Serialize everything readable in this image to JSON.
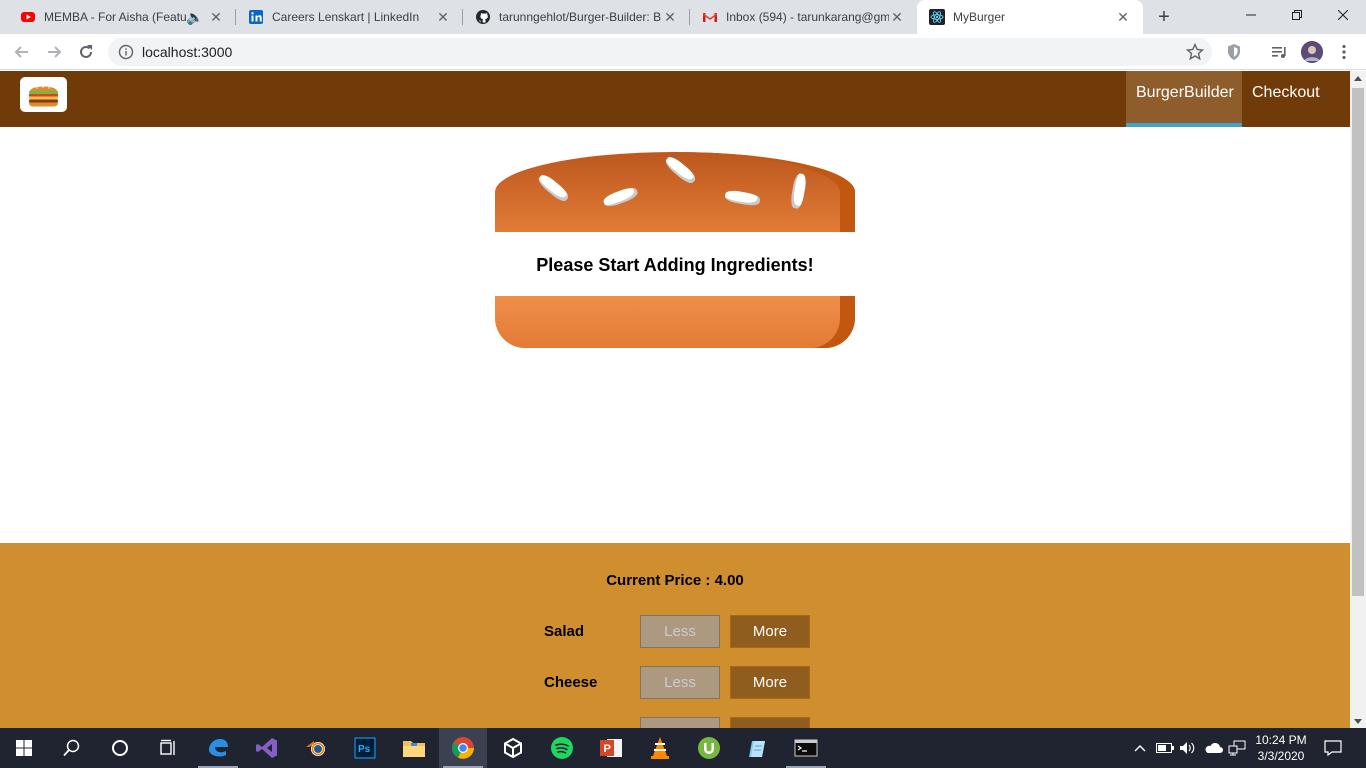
{
  "browser": {
    "tabs": [
      {
        "title": "MEMBA - For Aisha (Featu",
        "favicon": "youtube-icon"
      },
      {
        "title": "Careers Lenskart | LinkedIn",
        "favicon": "linkedin-icon"
      },
      {
        "title": "tarunngehlot/Burger-Builder: B",
        "favicon": "github-icon"
      },
      {
        "title": "Inbox (594) - tarunkarang@gm",
        "favicon": "gmail-icon"
      },
      {
        "title": "MyBurger",
        "favicon": "react-icon"
      }
    ],
    "active_tab": 4,
    "url": "localhost:3000"
  },
  "app": {
    "nav": {
      "items": [
        "BurgerBuilder",
        "Checkout"
      ],
      "active": "BurgerBuilder"
    },
    "burger": {
      "message": "Please Start Adding Ingredients!"
    },
    "controls": {
      "price_label": "Current Price : 4.00",
      "less_label": "Less",
      "more_label": "More",
      "ingredients": [
        "Salad",
        "Cheese"
      ]
    }
  },
  "taskbar": {
    "time": "10:24 PM",
    "date": "3/3/2020"
  },
  "colors": {
    "app_toolbar": "#703b09",
    "nav_active": "#8f5c2c",
    "nav_underline": "#40a4c8",
    "controls_bg": "#cf8f2e",
    "bread": "#e27b36",
    "more_button": "#8f5e1e",
    "less_button": "#ac9980"
  }
}
